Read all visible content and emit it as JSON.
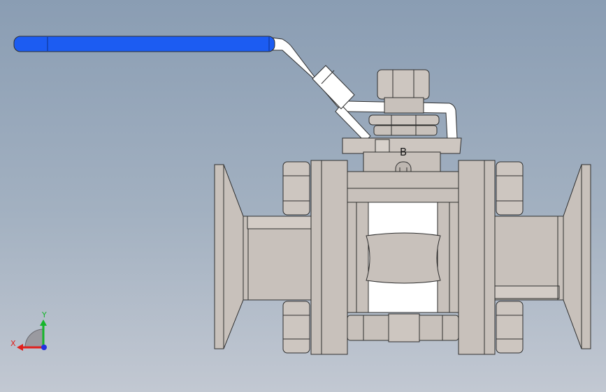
{
  "model": {
    "port_label": "B"
  },
  "triad": {
    "x_label": "X",
    "y_label": "Y"
  },
  "colors": {
    "body": "#c8c1bb",
    "body_light": "#d7d1cb",
    "handle_grip": "#1c5cf2",
    "white": "#ffffff",
    "axis_x": "#e0201c",
    "axis_y": "#16b52b",
    "axis_z": "#2430e0"
  }
}
